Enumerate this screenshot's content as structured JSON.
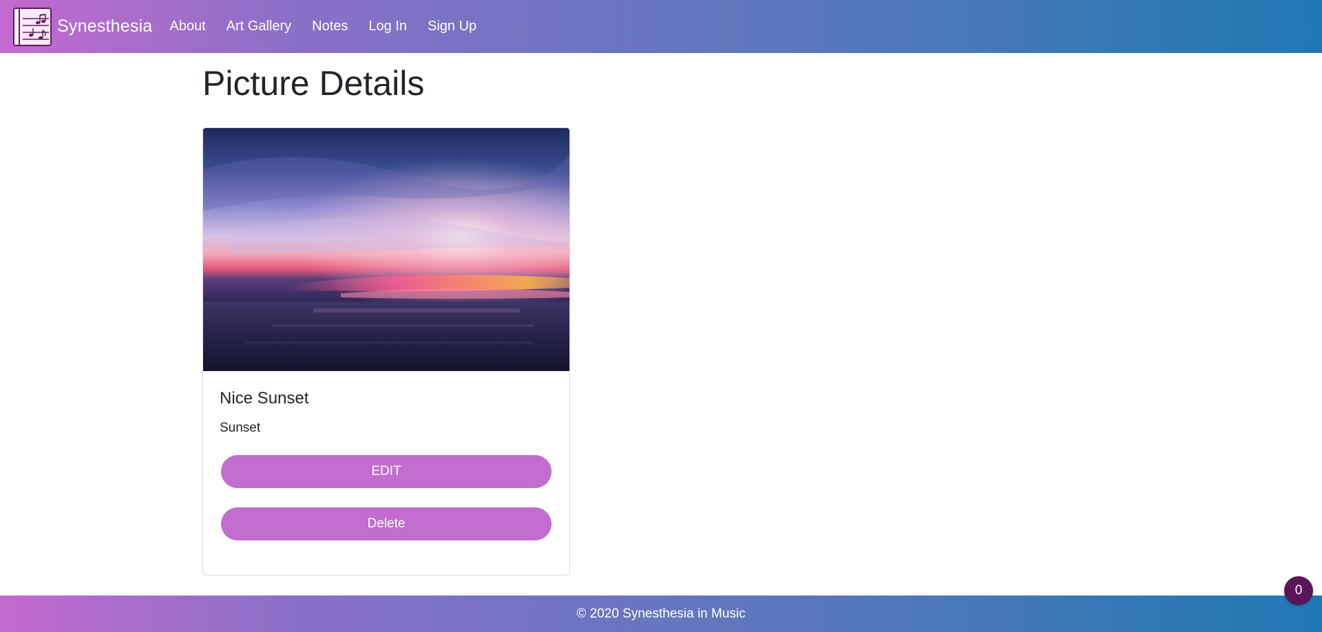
{
  "nav": {
    "brand": "Synesthesia",
    "links": [
      "About",
      "Art Gallery",
      "Notes",
      "Log In",
      "Sign Up"
    ]
  },
  "page": {
    "title": "Picture Details"
  },
  "card": {
    "image_icon": "sunset-photo",
    "title": "Nice Sunset",
    "category": "Sunset",
    "edit_label": "EDIT",
    "delete_label": "Delete"
  },
  "footer": {
    "text": "© 2020 Synesthesia in Music"
  },
  "badge": {
    "count": "0"
  },
  "colors": {
    "gradient_start": "#c36ad0",
    "gradient_end": "#1f78b2",
    "button": "#c26dcf",
    "badge": "#5a1458"
  }
}
